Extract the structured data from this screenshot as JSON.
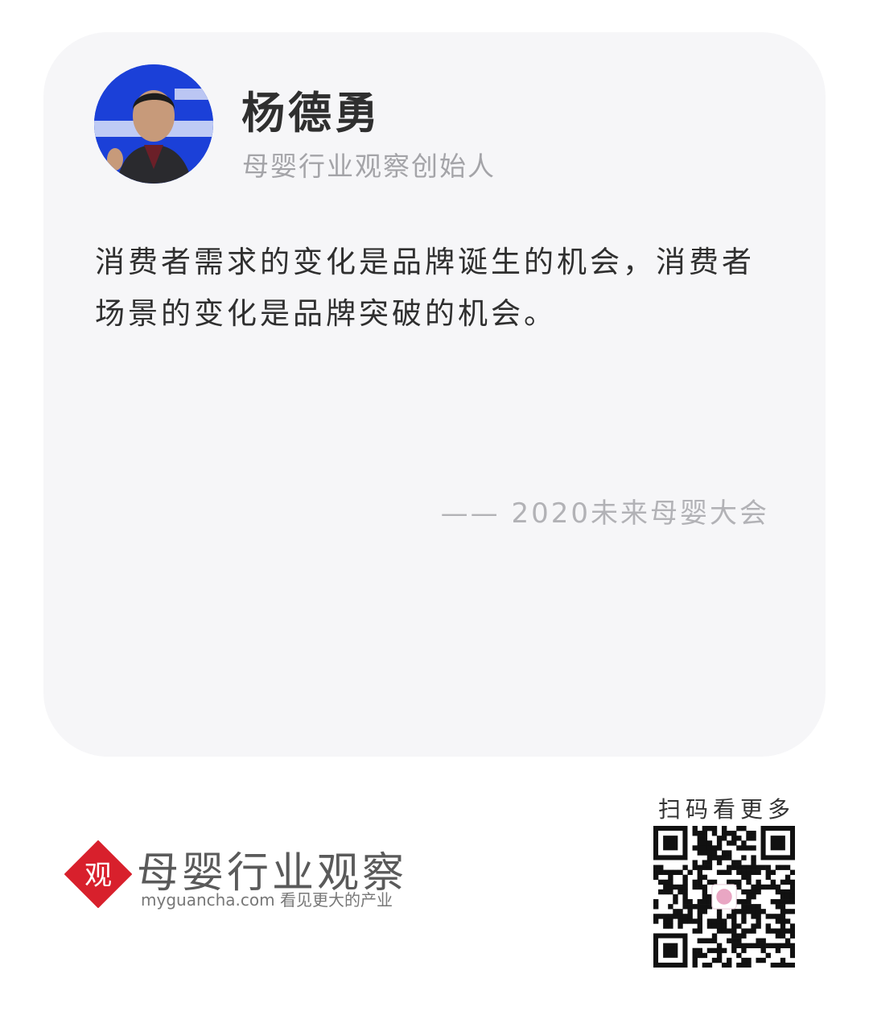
{
  "speaker": {
    "name": "杨德勇",
    "title": "母婴行业观察创始人"
  },
  "quote": {
    "text": "消费者需求的变化是品牌诞生的机会，消费者场景的变化是品牌突破的机会。",
    "source": "—— 2020未来母婴大会"
  },
  "brand": {
    "mark": "观",
    "name": "母婴行业观察",
    "site": "myguancha.com 看见更大的产业",
    "accent": "#d8202c"
  },
  "qr": {
    "caption": "扫码看更多"
  }
}
